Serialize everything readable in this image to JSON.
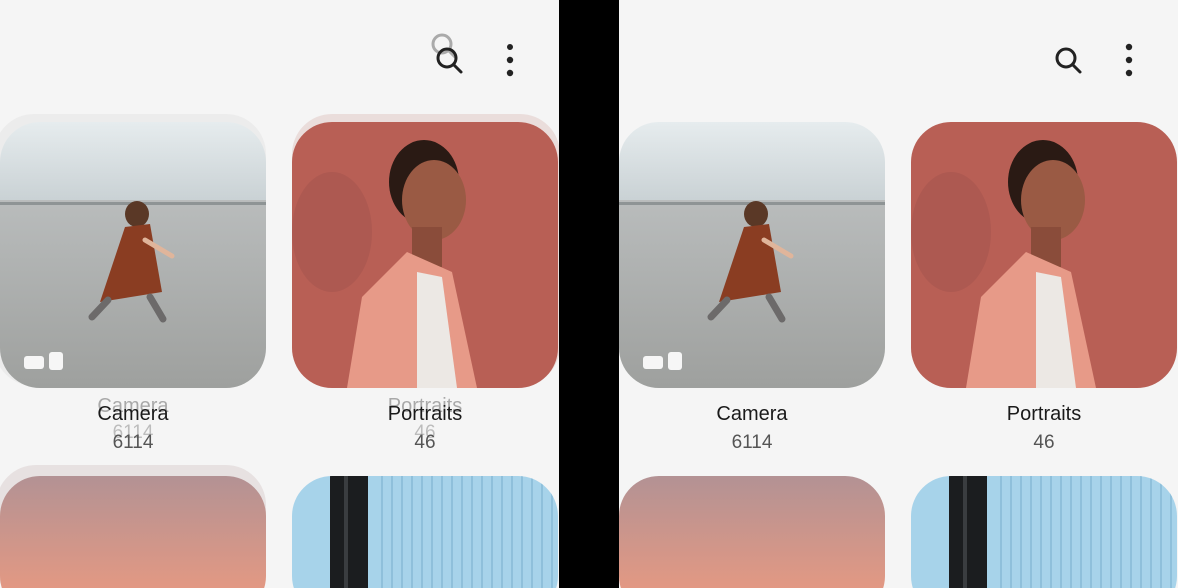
{
  "toolbar": {
    "search_icon": "search-icon",
    "more_icon": "more-vertical-icon"
  },
  "albums": [
    {
      "title": "Camera",
      "count": "6114"
    },
    {
      "title": "Portraits",
      "count": "46"
    }
  ],
  "colors": {
    "background": "#f5f5f5",
    "divider": "#000000",
    "portrait_bg": "#b85f55",
    "sky_tile": "#a7d3ea",
    "gradient_top": "#b39294",
    "gradient_bottom": "#ee9a7f"
  }
}
